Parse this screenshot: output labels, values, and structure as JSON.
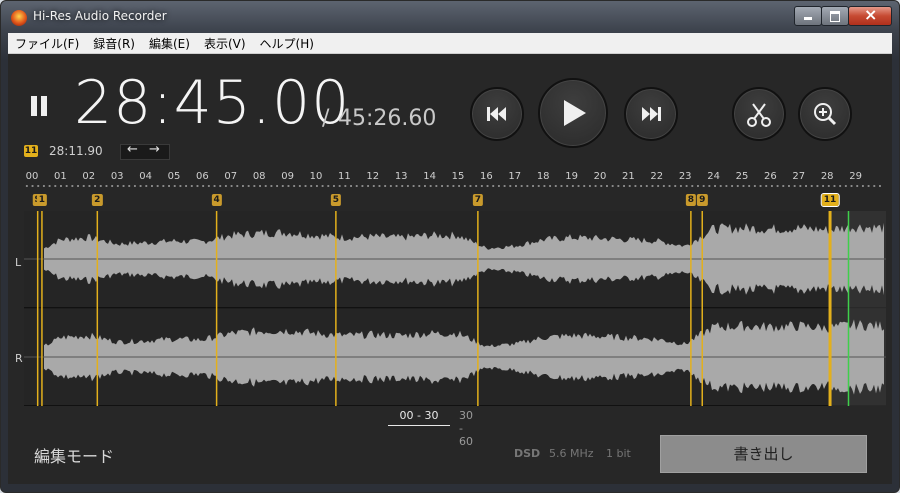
{
  "window": {
    "title": "Hi-Res Audio Recorder"
  },
  "menu": [
    "ファイル(F)",
    "録音(R)",
    "編集(E)",
    "表示(V)",
    "ヘルプ(H)"
  ],
  "transport": {
    "current_time": "28:45.00",
    "separator": "/",
    "total_time": "45:26.60"
  },
  "marker_info": {
    "badge": "11",
    "time": "28:11.90"
  },
  "ruler": {
    "ticks": [
      "00",
      "01",
      "02",
      "03",
      "04",
      "05",
      "06",
      "07",
      "08",
      "09",
      "10",
      "11",
      "12",
      "13",
      "14",
      "15",
      "16",
      "17",
      "18",
      "19",
      "20",
      "21",
      "22",
      "23",
      "24",
      "25",
      "26",
      "27",
      "28",
      "29"
    ]
  },
  "markers": [
    {
      "label": "S",
      "minute": 0.2
    },
    {
      "label": "1",
      "minute": 0.35
    },
    {
      "label": "2",
      "minute": 2.3
    },
    {
      "label": "4",
      "minute": 6.5
    },
    {
      "label": "5",
      "minute": 10.7
    },
    {
      "label": "7",
      "minute": 15.7
    },
    {
      "label": "8",
      "minute": 23.2
    },
    {
      "label": "9",
      "minute": 23.6
    },
    {
      "label": "11",
      "minute": 28.1
    }
  ],
  "playhead_minute": 28.75,
  "tracks": {
    "left": "L",
    "right": "R"
  },
  "range_tabs": {
    "active": "00 - 30",
    "inactive": "30 - 60"
  },
  "mode_label": "編集モード",
  "format": {
    "type": "DSD",
    "rate": "5.6 MHz",
    "bits": "1 bit"
  },
  "export_label": "書き出し",
  "colors": {
    "marker": "#e3b01c",
    "playhead": "#3fd04b",
    "waveform": "#a9a9a9"
  }
}
